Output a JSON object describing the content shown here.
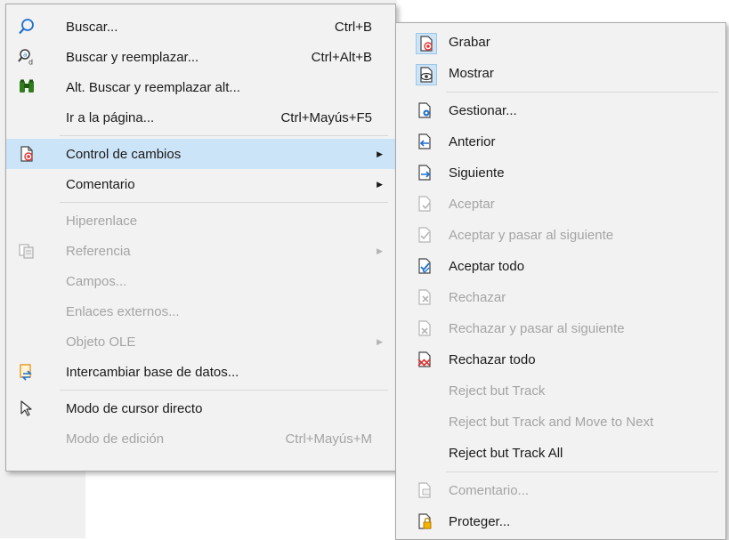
{
  "main_menu": {
    "buscar": {
      "label": "Buscar...",
      "shortcut": "Ctrl+B"
    },
    "buscar_reemplazar": {
      "label": "Buscar y reemplazar...",
      "shortcut": "Ctrl+Alt+B"
    },
    "alt_buscar": {
      "label": "Alt. Buscar y reemplazar alt..."
    },
    "ir_pagina": {
      "label": "Ir a la página...",
      "shortcut": "Ctrl+Mayús+F5"
    },
    "control_cambios": {
      "label": "Control de cambios"
    },
    "comentario": {
      "label": "Comentario"
    },
    "hiperenlace": {
      "label": "Hiperenlace"
    },
    "referencia": {
      "label": "Referencia"
    },
    "campos": {
      "label": "Campos..."
    },
    "enlaces_externos": {
      "label": "Enlaces externos..."
    },
    "objeto_ole": {
      "label": "Objeto OLE"
    },
    "intercambiar_bd": {
      "label": "Intercambiar base de datos..."
    },
    "modo_cursor": {
      "label": "Modo de cursor directo"
    },
    "modo_edicion": {
      "label": "Modo de edición",
      "shortcut": "Ctrl+Mayús+M"
    }
  },
  "submenu": {
    "grabar": {
      "label": "Grabar"
    },
    "mostrar": {
      "label": "Mostrar"
    },
    "gestionar": {
      "label": "Gestionar..."
    },
    "anterior": {
      "label": "Anterior"
    },
    "siguiente": {
      "label": "Siguiente"
    },
    "aceptar": {
      "label": "Aceptar"
    },
    "aceptar_pasar": {
      "label": "Aceptar y pasar al siguiente"
    },
    "aceptar_todo": {
      "label": "Aceptar todo"
    },
    "rechazar": {
      "label": "Rechazar"
    },
    "rechazar_pasar": {
      "label": "Rechazar y pasar al siguiente"
    },
    "rechazar_todo": {
      "label": "Rechazar todo"
    },
    "reject_track": {
      "label": "Reject but Track"
    },
    "reject_track_next": {
      "label": "Reject but Track and Move to Next"
    },
    "reject_track_all": {
      "label": "Reject but Track All"
    },
    "comentario": {
      "label": "Comentario..."
    },
    "proteger": {
      "label": "Proteger..."
    }
  },
  "colors": {
    "highlight": "#cce4f7",
    "menu_bg": "#f2f2f2",
    "disabled_text": "#a4a4a4"
  }
}
